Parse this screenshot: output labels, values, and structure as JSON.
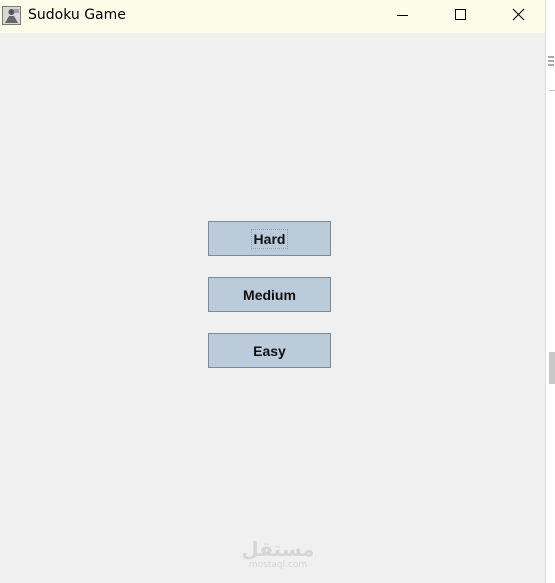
{
  "window": {
    "title": "Sudoku Game",
    "controls": {
      "minimize_icon": "minimize-icon",
      "maximize_icon": "maximize-icon",
      "close_icon": "close-icon"
    }
  },
  "main": {
    "buttons": [
      {
        "label": "Hard"
      },
      {
        "label": "Medium"
      },
      {
        "label": "Easy"
      }
    ]
  },
  "watermark": {
    "logo_text": "مستقل",
    "domain": "mostaql.com"
  },
  "colors": {
    "titlebar_bg": "#fbfde8",
    "window_bg": "#f0f0f0",
    "button_bg": "#bccbda",
    "button_border": "#7a8a9c"
  }
}
